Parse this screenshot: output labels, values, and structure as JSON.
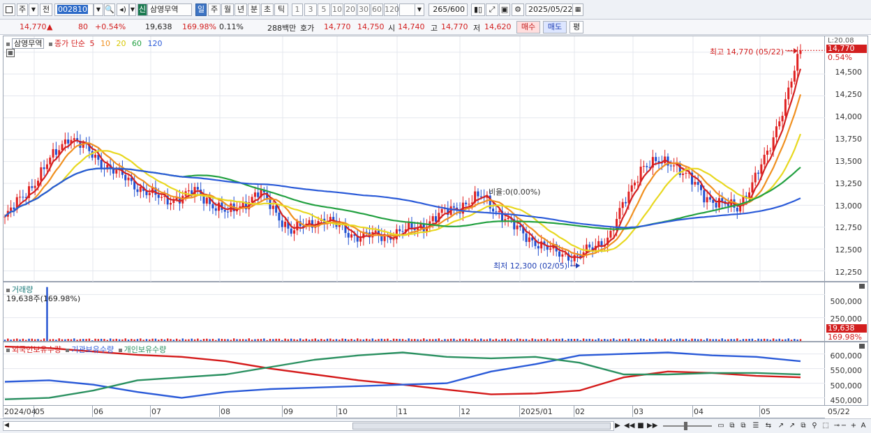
{
  "toolbar": {
    "market_label": "주",
    "prev_label": "전",
    "code": "002810",
    "stock_name": "삼영무역",
    "stock_badge": "신",
    "periods": [
      "일",
      "주",
      "월",
      "년",
      "분",
      "초",
      "틱"
    ],
    "active_period": "일",
    "intervals": [
      "1",
      "3",
      "5",
      "10",
      "20",
      "30",
      "60",
      "120"
    ],
    "count": "265",
    "count_max": "/600",
    "date": "2025/05/22"
  },
  "quote": {
    "price": "14,770",
    "change_arrow": "▲",
    "change": "80",
    "change_pct": "+0.54%",
    "volume": "19,638",
    "volume_ratio": "169.98%",
    "turnover_rate": "0.11%",
    "trade_value": "288백만",
    "hoga_label": "호가",
    "ask": "14,770",
    "bid": "14,750",
    "open_label": "시",
    "open": "14,740",
    "high_label": "고",
    "high": "14,770",
    "low_label": "저",
    "low": "14,620",
    "buy_label": "매수",
    "sell_label": "매도",
    "eval_label": "평"
  },
  "price_panel": {
    "stock_chip": "삼영무역",
    "legend_prefix": "종가 단순",
    "ma_periods": [
      "5",
      "10",
      "20",
      "60",
      "120"
    ],
    "ma_colors": [
      "#d42020",
      "#f09020",
      "#e8d820",
      "#22a040",
      "#2a5ad8"
    ],
    "corner_label": "L:20.08",
    "last_price_tag": "14,770",
    "last_pct": "0.54%",
    "high_note": "최고 14,770 (05/22)",
    "low_note": "최저 12,300 (02/05)",
    "ratio_note": "비율:0(0.00%)",
    "y_ticks": [
      "14,500",
      "14,250",
      "14,000",
      "13,750",
      "13,500",
      "13,250",
      "13,000",
      "12,750",
      "12,500",
      "12,250"
    ]
  },
  "volume_panel": {
    "title": "거래량",
    "value_note": "19,638주(169.98%)",
    "y_ticks": [
      "500,000",
      "250,000"
    ],
    "tag_value": "19,638",
    "tag_pct": "169.98%"
  },
  "holdings_panel": {
    "legend": [
      "외국인보유수량",
      "기관보유수량",
      "개인보유수량"
    ],
    "legend_colors": [
      "#d41a1a",
      "#2a5ad8",
      "#2a9060"
    ],
    "y_ticks": [
      "600,000",
      "550,000",
      "500,000",
      "450,000"
    ]
  },
  "xaxis": {
    "labels": [
      "2024/04",
      "05",
      "06",
      "07",
      "08",
      "09",
      "10",
      "11",
      "12",
      "2025/01",
      "02",
      "03",
      "04",
      "05"
    ],
    "right_label": "05/22"
  },
  "chart_data": [
    {
      "type": "candlestick",
      "title": "삼영무역",
      "ylim": [
        12150,
        14900
      ],
      "points_estimated": [
        {
          "date": "2024/04",
          "close": 12850
        },
        {
          "date": "05",
          "close": 13300
        },
        {
          "date": "05 mid",
          "close": 13800
        },
        {
          "date": "06",
          "close": 13500
        },
        {
          "date": "06 mid",
          "close": 13250
        },
        {
          "date": "07",
          "close": 13050
        },
        {
          "date": "07 mid",
          "close": 13150
        },
        {
          "date": "08",
          "close": 12900
        },
        {
          "date": "08 mid",
          "close": 13150
        },
        {
          "date": "09",
          "close": 12700
        },
        {
          "date": "09 mid",
          "close": 12850
        },
        {
          "date": "10",
          "close": 12650
        },
        {
          "date": "11",
          "close": 12650
        },
        {
          "date": "11 mid",
          "close": 12750
        },
        {
          "date": "12",
          "close": 12950
        },
        {
          "date": "12 mid",
          "close": 13100
        },
        {
          "date": "2025/01",
          "close": 12750
        },
        {
          "date": "01 mid",
          "close": 12500
        },
        {
          "date": "02",
          "close": 12400
        },
        {
          "date": "02 mid",
          "close": 12650
        },
        {
          "date": "03",
          "close": 13450
        },
        {
          "date": "03 mid",
          "close": 13500
        },
        {
          "date": "04",
          "close": 13100
        },
        {
          "date": "04 mid",
          "close": 12950
        },
        {
          "date": "05",
          "close": 13600
        },
        {
          "date": "05/22",
          "close": 14770
        }
      ],
      "high": {
        "value": 14770,
        "date": "05/22"
      },
      "low": {
        "value": 12300,
        "date": "02/05"
      }
    },
    {
      "type": "bar",
      "title": "거래량",
      "ylim": [
        0,
        600000
      ],
      "values_estimated": [
        {
          "date": "05 peak",
          "value": 580000
        },
        {
          "date": "05/22",
          "value": 19638
        }
      ]
    },
    {
      "type": "line",
      "title": "보유수량",
      "ylim": [
        430000,
        630000
      ],
      "series": [
        {
          "name": "외국인보유수량",
          "values": [
            625000,
            620000,
            608000,
            597000,
            590000,
            575000,
            550000,
            530000,
            510000,
            495000,
            478000,
            462000,
            465000,
            475000,
            520000,
            540000,
            535000,
            525000,
            520000
          ]
        },
        {
          "name": "기관보유수량",
          "values": [
            505000,
            510000,
            495000,
            470000,
            450000,
            470000,
            480000,
            485000,
            490000,
            495000,
            500000,
            540000,
            565000,
            595000,
            600000,
            605000,
            595000,
            590000,
            575000
          ]
        },
        {
          "name": "개인보유수량",
          "values": [
            445000,
            450000,
            475000,
            510000,
            520000,
            530000,
            555000,
            580000,
            595000,
            605000,
            590000,
            585000,
            590000,
            570000,
            530000,
            530000,
            535000,
            535000,
            530000
          ]
        }
      ]
    }
  ]
}
